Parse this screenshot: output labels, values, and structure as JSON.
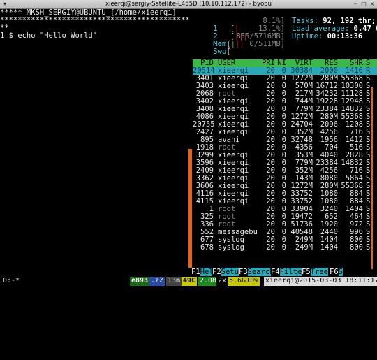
{
  "window": {
    "title": "xieerqi@sergiy-Satellite-L455D (10.10.112.172) - byobu"
  },
  "left_pane": {
    "lines": [
      "***** MKSH_SERGIY@UBUNTU_[/home/xieerqi]",
      "**********************************************",
      "**",
      "1 $ echo \"Hello World\""
    ]
  },
  "meters": [
    {
      "label": "1",
      "bar": "[|",
      "value": "8.1%]"
    },
    {
      "label": "2",
      "bar": "[|||",
      "value": "13.1%]"
    },
    {
      "label": "Mem",
      "bar": "[|||",
      "value": "855/5716MB]"
    },
    {
      "label": "Swp",
      "bar": "[",
      "value": "0/511MB]"
    }
  ],
  "summary": {
    "tasks_label": "Tasks: ",
    "tasks": "92, 192 thr;",
    "load_label": "Load average: ",
    "load": "0.47 0",
    "uptime_label": "Uptime: ",
    "uptime": "00:13:36"
  },
  "columns": {
    "pid": "PID",
    "user": "USER",
    "pri": "PRI",
    "ni": "NI",
    "virt": "VIRT",
    "res": "RES",
    "shr": "SHR",
    "s": "S"
  },
  "processes": [
    {
      "pid": "20514",
      "user": "xieerqi",
      "pri": "20",
      "ni": "0",
      "virt": "30384",
      "res": "2000",
      "shr": "1416",
      "s": "R",
      "sel": true
    },
    {
      "pid": "3401",
      "user": "xieerqi",
      "pri": "20",
      "ni": "0",
      "virt": "1272M",
      "res": "280M",
      "shr": "55368",
      "s": "S"
    },
    {
      "pid": "3403",
      "user": "xieerqi",
      "pri": "20",
      "ni": "0",
      "virt": "570M",
      "res": "16712",
      "shr": "10300",
      "s": "S"
    },
    {
      "pid": "2068",
      "user": "root",
      "pri": "20",
      "ni": "0",
      "virt": "217M",
      "res": "34232",
      "shr": "11128",
      "s": "S"
    },
    {
      "pid": "3402",
      "user": "xieerqi",
      "pri": "20",
      "ni": "0",
      "virt": "744M",
      "res": "19228",
      "shr": "12948",
      "s": "S"
    },
    {
      "pid": "3408",
      "user": "xieerqi",
      "pri": "20",
      "ni": "0",
      "virt": "779M",
      "res": "23384",
      "shr": "14832",
      "s": "S"
    },
    {
      "pid": "4086",
      "user": "xieerqi",
      "pri": "20",
      "ni": "0",
      "virt": "1272M",
      "res": "280M",
      "shr": "55368",
      "s": "S"
    },
    {
      "pid": "20755",
      "user": "xieerqi",
      "pri": "20",
      "ni": "0",
      "virt": "24704",
      "res": "2096",
      "shr": "1208",
      "s": "S"
    },
    {
      "pid": "2427",
      "user": "xieerqi",
      "pri": "20",
      "ni": "0",
      "virt": "352M",
      "res": "4256",
      "shr": "716",
      "s": "S"
    },
    {
      "pid": "895",
      "user": "avahi",
      "pri": "20",
      "ni": "0",
      "virt": "32748",
      "res": "1956",
      "shr": "1412",
      "s": "S"
    },
    {
      "pid": "1918",
      "user": "root",
      "pri": "20",
      "ni": "0",
      "virt": "4356",
      "res": "704",
      "shr": "516",
      "s": "S"
    },
    {
      "pid": "3299",
      "user": "xieerqi",
      "pri": "20",
      "ni": "0",
      "virt": "353M",
      "res": "4040",
      "shr": "2828",
      "s": "S"
    },
    {
      "pid": "3596",
      "user": "xieerqi",
      "pri": "20",
      "ni": "0",
      "virt": "779M",
      "res": "23384",
      "shr": "14832",
      "s": "S"
    },
    {
      "pid": "2409",
      "user": "xieerqi",
      "pri": "20",
      "ni": "0",
      "virt": "352M",
      "res": "4256",
      "shr": "716",
      "s": "S"
    },
    {
      "pid": "3362",
      "user": "xieerqi",
      "pri": "20",
      "ni": "0",
      "virt": "143M",
      "res": "8080",
      "shr": "5864",
      "s": "S"
    },
    {
      "pid": "3606",
      "user": "xieerqi",
      "pri": "20",
      "ni": "0",
      "virt": "1272M",
      "res": "280M",
      "shr": "55368",
      "s": "S"
    },
    {
      "pid": "4116",
      "user": "xieerqi",
      "pri": "20",
      "ni": "0",
      "virt": "33752",
      "res": "1080",
      "shr": "884",
      "s": "S"
    },
    {
      "pid": "4115",
      "user": "xieerqi",
      "pri": "20",
      "ni": "0",
      "virt": "33752",
      "res": "1080",
      "shr": "884",
      "s": "S"
    },
    {
      "pid": "1",
      "user": "root",
      "pri": "20",
      "ni": "0",
      "virt": "33904",
      "res": "3240",
      "shr": "1404",
      "s": "S"
    },
    {
      "pid": "325",
      "user": "root",
      "pri": "20",
      "ni": "0",
      "virt": "19472",
      "res": "652",
      "shr": "464",
      "s": "S"
    },
    {
      "pid": "336",
      "user": "root",
      "pri": "20",
      "ni": "0",
      "virt": "51736",
      "res": "1920",
      "shr": "972",
      "s": "S"
    },
    {
      "pid": "552",
      "user": "messagebu",
      "pri": "20",
      "ni": "0",
      "virt": "40548",
      "res": "2440",
      "shr": "996",
      "s": "S"
    },
    {
      "pid": "677",
      "user": "syslog",
      "pri": "20",
      "ni": "0",
      "virt": "249M",
      "res": "1404",
      "shr": "800",
      "s": "S"
    },
    {
      "pid": "678",
      "user": "syslog",
      "pri": "20",
      "ni": "0",
      "virt": "249M",
      "res": "1404",
      "shr": "800",
      "s": "S"
    }
  ],
  "fkeys": [
    {
      "num": "F1",
      "label": "Help"
    },
    {
      "num": "F2",
      "label": "Setup"
    },
    {
      "num": "F3",
      "label": "Search"
    },
    {
      "num": "F4",
      "label": "Filter"
    },
    {
      "num": "F5",
      "label": "Tree"
    },
    {
      "num": "F6",
      "label": "S"
    }
  ],
  "statusbar": {
    "session": "0:-*",
    "updates": "e893",
    "z": ".zZ",
    "mem": "13m",
    "temp": "49C",
    "load": "2.08",
    "cpu_count": "2x",
    "freq": "5.6G10%",
    "host": "xieerqi@2015-03-03 18:11:17"
  },
  "colors": {
    "accent_green": "#3cb84a",
    "accent_cyan": "#2aa8b8",
    "scroll_orange": "#e8640c"
  }
}
